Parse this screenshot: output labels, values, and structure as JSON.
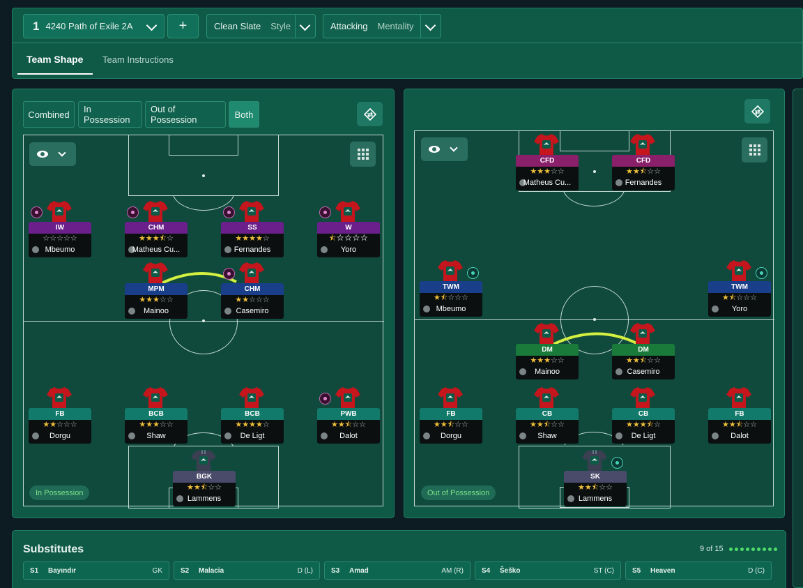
{
  "tactic": {
    "slot": "1",
    "name": "4240 Path of Exile 2A",
    "add_label": "+"
  },
  "style": {
    "value": "Clean Slate",
    "label": "Style"
  },
  "mentality": {
    "value": "Attacking",
    "label": "Mentality"
  },
  "tabs": [
    {
      "label": "Team Shape"
    },
    {
      "label": "Team Instructions"
    }
  ],
  "view_buttons": [
    {
      "label": "Combined"
    },
    {
      "label": "In Possession"
    },
    {
      "label": "Out of Possession"
    },
    {
      "label": "Both"
    }
  ],
  "pitch_left": {
    "phase": "In Possession",
    "players": [
      {
        "role": "IW",
        "name": "Mbeumo",
        "stars": 0,
        "half": false,
        "color": "#6a1f8a",
        "dot": true
      },
      {
        "role": "CHM",
        "name": "Matheus Cu...",
        "stars": 3,
        "half": true,
        "color": "#6a1f8a",
        "dot": true
      },
      {
        "role": "SS",
        "name": "Fernandes",
        "stars": 4,
        "half": false,
        "color": "#6a1f8a",
        "dot": true
      },
      {
        "role": "W",
        "name": "Yoro",
        "stars": 0,
        "half": true,
        "color": "#6a1f8a",
        "dot": true
      },
      {
        "role": "MPM",
        "name": "Mainoo",
        "stars": 3,
        "half": false,
        "color": "#1a3f8a",
        "dot": false
      },
      {
        "role": "CHM",
        "name": "Casemiro",
        "stars": 2,
        "half": false,
        "color": "#1a3f8a",
        "dot": true
      },
      {
        "role": "FB",
        "name": "Dorgu",
        "stars": 2,
        "half": false,
        "color": "#117a6a",
        "dot": false
      },
      {
        "role": "BCB",
        "name": "Shaw",
        "stars": 3,
        "half": false,
        "color": "#117a6a",
        "dot": false
      },
      {
        "role": "BCB",
        "name": "De Ligt",
        "stars": 4,
        "half": false,
        "color": "#117a6a",
        "dot": false
      },
      {
        "role": "PWB",
        "name": "Dalot",
        "stars": 2,
        "half": true,
        "color": "#117a6a",
        "dot": true
      },
      {
        "role": "BGK",
        "name": "Lammens",
        "stars": 2,
        "half": true,
        "color": "#4a4a6a",
        "dot": false
      }
    ]
  },
  "pitch_right": {
    "phase": "Out of Possession",
    "players": [
      {
        "role": "CFD",
        "name": "Matheus Cu...",
        "stars": 3,
        "half": false,
        "color": "#8a1f6a",
        "dot": false
      },
      {
        "role": "CFD",
        "name": "Fernandes",
        "stars": 2,
        "half": true,
        "color": "#8a1f6a",
        "dot": false
      },
      {
        "role": "TWM",
        "name": "Mbeumo",
        "stars": 1,
        "half": true,
        "color": "#1a3f8a",
        "dot": true
      },
      {
        "role": "TWM",
        "name": "Yoro",
        "stars": 1,
        "half": true,
        "color": "#1a3f8a",
        "dot": true
      },
      {
        "role": "DM",
        "name": "Mainoo",
        "stars": 3,
        "half": false,
        "color": "#1a7a3a",
        "dot": false
      },
      {
        "role": "DM",
        "name": "Casemiro",
        "stars": 2,
        "half": true,
        "color": "#1a7a3a",
        "dot": false
      },
      {
        "role": "FB",
        "name": "Dorgu",
        "stars": 2,
        "half": true,
        "color": "#117a6a",
        "dot": false
      },
      {
        "role": "CB",
        "name": "Shaw",
        "stars": 2,
        "half": true,
        "color": "#117a6a",
        "dot": false
      },
      {
        "role": "CB",
        "name": "De Ligt",
        "stars": 3,
        "half": true,
        "color": "#117a6a",
        "dot": false
      },
      {
        "role": "FB",
        "name": "Dalot",
        "stars": 2,
        "half": true,
        "color": "#117a6a",
        "dot": false
      },
      {
        "role": "SK",
        "name": "Lammens",
        "stars": 2,
        "half": true,
        "color": "#4a4a6a",
        "dot": true
      }
    ]
  },
  "substitutes": {
    "title": "Substitutes",
    "count": "9 of 15",
    "items": [
      {
        "slot": "S1",
        "name": "Bayındır",
        "pos": "GK"
      },
      {
        "slot": "S2",
        "name": "Malacia",
        "pos": "D (L)"
      },
      {
        "slot": "S3",
        "name": "Amad",
        "pos": "AM (R)"
      },
      {
        "slot": "S4",
        "name": "Šeško",
        "pos": "ST (C)"
      },
      {
        "slot": "S5",
        "name": "Heaven",
        "pos": "D (C)"
      }
    ]
  },
  "icons": {
    "swap": "swap-icon",
    "eye": "eye-icon",
    "grid": "grid-icon",
    "shirt": "shirt-icon"
  },
  "colors": {
    "accent": "#1f8a70",
    "link": "#d4f040",
    "panel": "#0f5a47"
  }
}
